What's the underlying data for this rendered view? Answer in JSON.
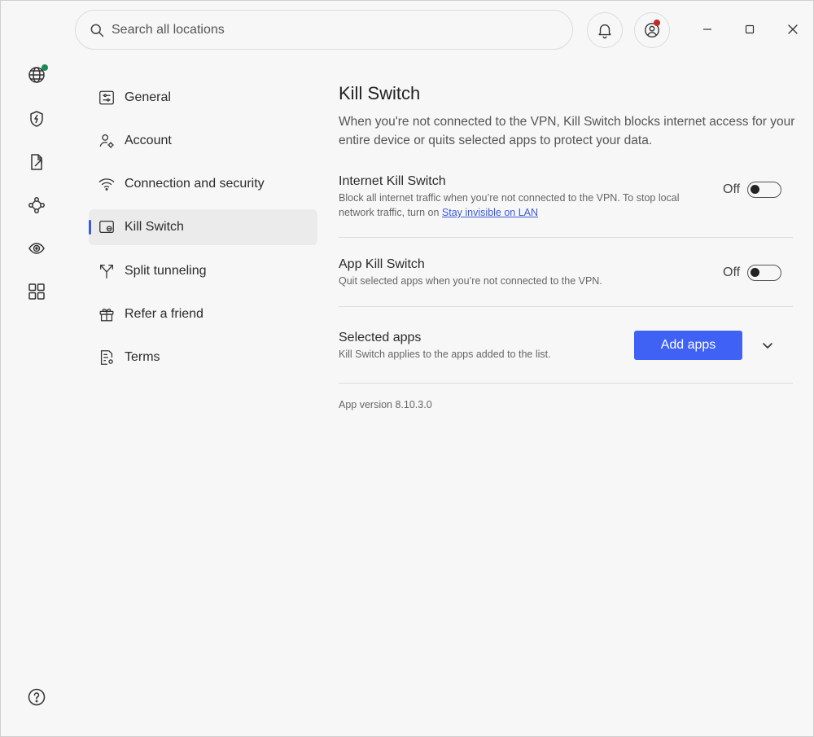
{
  "search": {
    "placeholder": "Search all locations"
  },
  "nav": {
    "items": [
      {
        "label": "General"
      },
      {
        "label": "Account"
      },
      {
        "label": "Connection and security"
      },
      {
        "label": "Kill Switch"
      },
      {
        "label": "Split tunneling"
      },
      {
        "label": "Refer a friend"
      },
      {
        "label": "Terms"
      }
    ],
    "active": "Kill Switch"
  },
  "page": {
    "title": "Kill Switch",
    "description": "When you're not connected to the VPN, Kill Switch blocks internet access for your entire device or quits selected apps to protect your data."
  },
  "internet_kill_switch": {
    "title": "Internet Kill Switch",
    "description": "Block all internet traffic when you’re not connected to the VPN. To stop local network traffic, turn on",
    "link": "Stay invisible on LAN",
    "state": "Off"
  },
  "app_kill_switch": {
    "title": "App Kill Switch",
    "description": "Quit selected apps when you’re not connected to the VPN.",
    "state": "Off"
  },
  "selected_apps": {
    "title": "Selected apps",
    "description": "Kill Switch applies to the apps added to the list.",
    "button": "Add apps"
  },
  "version": "App version 8.10.3.0",
  "colors": {
    "accent": "#3f62f5",
    "link": "#3a5bd9",
    "status_dot_green": "#1e8a5a",
    "status_dot_red": "#c62828"
  }
}
